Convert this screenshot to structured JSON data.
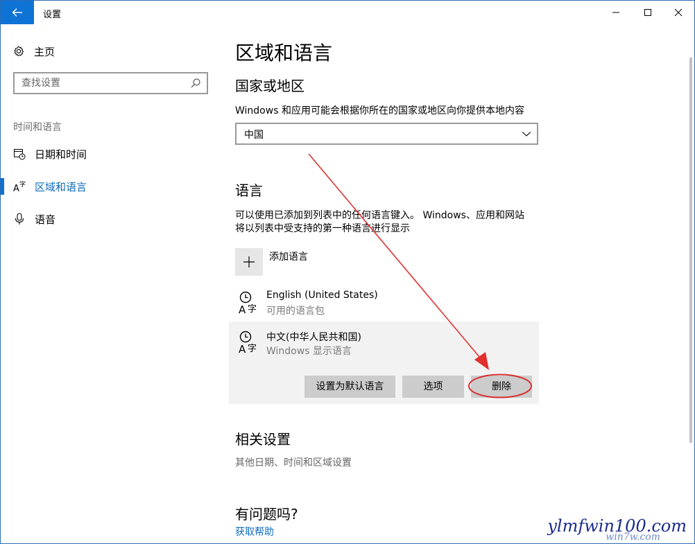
{
  "window": {
    "title": "设置",
    "icons": {
      "back": "back-arrow-icon",
      "minimize": "minimize-icon",
      "maximize": "maximize-icon",
      "close": "close-icon"
    }
  },
  "sidebar": {
    "home_label": "主页",
    "search_placeholder": "查找设置",
    "section_title": "时间和语言",
    "items": [
      {
        "label": "日期和时间",
        "icon": "calendar-clock-icon",
        "active": false
      },
      {
        "label": "区域和语言",
        "icon": "region-language-icon",
        "active": true
      },
      {
        "label": "语音",
        "icon": "microphone-icon",
        "active": false
      }
    ]
  },
  "main": {
    "page_title": "区域和语言",
    "country": {
      "heading": "国家或地区",
      "description": "Windows 和应用可能会根据你所在的国家或地区向你提供本地内容",
      "selected": "中国"
    },
    "language": {
      "heading": "语言",
      "description_line1": "可以使用已添加到列表中的任何语言键入。 Windows、应用和网站",
      "description_line2": "将以列表中受支持的第一种语言进行显示",
      "add_label": "添加语言",
      "languages": [
        {
          "name": "English (United States)",
          "status": "可用的语言包"
        },
        {
          "name": "中文(中华人民共和国)",
          "status": "Windows 显示语言"
        }
      ],
      "actions": {
        "set_default": "设置为默认语言",
        "options": "选项",
        "remove": "删除"
      }
    },
    "related": {
      "heading": "相关设置",
      "link": "其他日期、时间和区域设置"
    },
    "help": {
      "heading": "有问题吗?",
      "link": "获取帮助"
    }
  },
  "annotation": {
    "arrow_color": "#e03030",
    "highlight_target": "删除"
  },
  "watermark": {
    "main": "ylmfwin100.com",
    "sub": "win7w.com"
  },
  "colors": {
    "accent": "#0f73d6",
    "link": "#0f6cbd",
    "button_bg": "#cccccc",
    "selected_bg": "#f2f2f2"
  }
}
